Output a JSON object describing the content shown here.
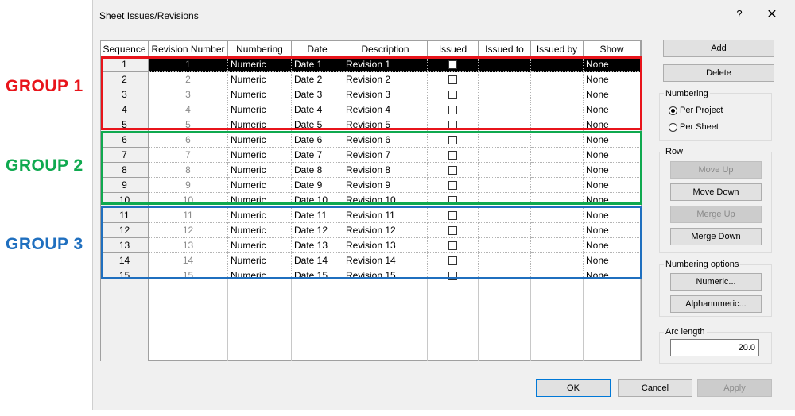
{
  "groups": [
    {
      "label": "GROUP 1",
      "color": "#e8141b"
    },
    {
      "label": "GROUP 2",
      "color": "#0fa94f"
    },
    {
      "label": "GROUP 3",
      "color": "#1f6fbf"
    }
  ],
  "dialog": {
    "title": "Sheet Issues/Revisions",
    "help": "?",
    "close": "✕"
  },
  "table": {
    "columns": [
      "Sequence",
      "Revision Number",
      "Numbering",
      "Date",
      "Description",
      "Issued",
      "Issued to",
      "Issued by",
      "Show"
    ],
    "rows": [
      {
        "seq": "1",
        "num": "1",
        "numbering": "Numeric",
        "date": "Date 1",
        "desc": "Revision 1",
        "show": "None"
      },
      {
        "seq": "2",
        "num": "2",
        "numbering": "Numeric",
        "date": "Date 2",
        "desc": "Revision 2",
        "show": "None"
      },
      {
        "seq": "3",
        "num": "3",
        "numbering": "Numeric",
        "date": "Date 3",
        "desc": "Revision 3",
        "show": "None"
      },
      {
        "seq": "4",
        "num": "4",
        "numbering": "Numeric",
        "date": "Date 4",
        "desc": "Revision 4",
        "show": "None"
      },
      {
        "seq": "5",
        "num": "5",
        "numbering": "Numeric",
        "date": "Date 5",
        "desc": "Revision 5",
        "show": "None"
      },
      {
        "seq": "6",
        "num": "6",
        "numbering": "Numeric",
        "date": "Date 6",
        "desc": "Revision 6",
        "show": "None"
      },
      {
        "seq": "7",
        "num": "7",
        "numbering": "Numeric",
        "date": "Date 7",
        "desc": "Revision 7",
        "show": "None"
      },
      {
        "seq": "8",
        "num": "8",
        "numbering": "Numeric",
        "date": "Date 8",
        "desc": "Revision 8",
        "show": "None"
      },
      {
        "seq": "9",
        "num": "9",
        "numbering": "Numeric",
        "date": "Date 9",
        "desc": "Revision 9",
        "show": "None"
      },
      {
        "seq": "10",
        "num": "10",
        "numbering": "Numeric",
        "date": "Date 10",
        "desc": "Revision 10",
        "show": "None"
      },
      {
        "seq": "11",
        "num": "11",
        "numbering": "Numeric",
        "date": "Date 11",
        "desc": "Revision 11",
        "show": "None"
      },
      {
        "seq": "12",
        "num": "12",
        "numbering": "Numeric",
        "date": "Date 12",
        "desc": "Revision 12",
        "show": "None"
      },
      {
        "seq": "13",
        "num": "13",
        "numbering": "Numeric",
        "date": "Date 13",
        "desc": "Revision 13",
        "show": "None"
      },
      {
        "seq": "14",
        "num": "14",
        "numbering": "Numeric",
        "date": "Date 14",
        "desc": "Revision 14",
        "show": "None"
      },
      {
        "seq": "15",
        "num": "15",
        "numbering": "Numeric",
        "date": "Date 15",
        "desc": "Revision 15",
        "show": "None"
      }
    ]
  },
  "buttons": {
    "add": "Add",
    "delete": "Delete",
    "move_up": "Move Up",
    "move_down": "Move Down",
    "merge_up": "Merge Up",
    "merge_down": "Merge Down",
    "numeric": "Numeric...",
    "alphanumeric": "Alphanumeric...",
    "ok": "OK",
    "cancel": "Cancel",
    "apply": "Apply"
  },
  "numbering": {
    "title": "Numbering",
    "per_project": "Per Project",
    "per_sheet": "Per Sheet",
    "selected": "per_project"
  },
  "row_panel": {
    "title": "Row"
  },
  "numbering_options": {
    "title": "Numbering options"
  },
  "arc_length": {
    "title": "Arc length",
    "value": "20.0"
  }
}
